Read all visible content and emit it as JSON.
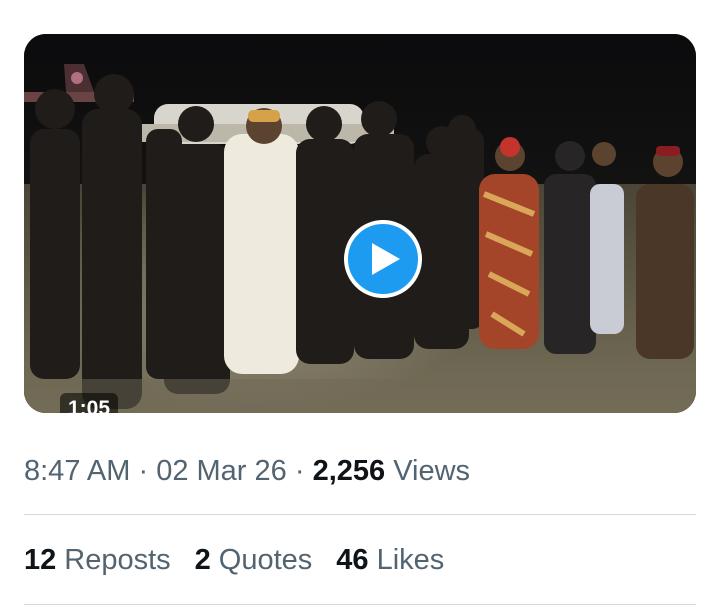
{
  "video": {
    "duration": "1:05",
    "play_icon": "play-icon",
    "play_color": "#1d9bf0"
  },
  "meta": {
    "time": "8:47 AM",
    "separator": "·",
    "date": "02 Mar 26",
    "views_count": "2,256",
    "views_label": "Views"
  },
  "stats": {
    "reposts_count": "12",
    "reposts_label": "Reposts",
    "quotes_count": "2",
    "quotes_label": "Quotes",
    "likes_count": "46",
    "likes_label": "Likes"
  },
  "colors": {
    "text_primary": "#0f1419",
    "text_secondary": "#536471",
    "divider": "#cfd9de"
  }
}
